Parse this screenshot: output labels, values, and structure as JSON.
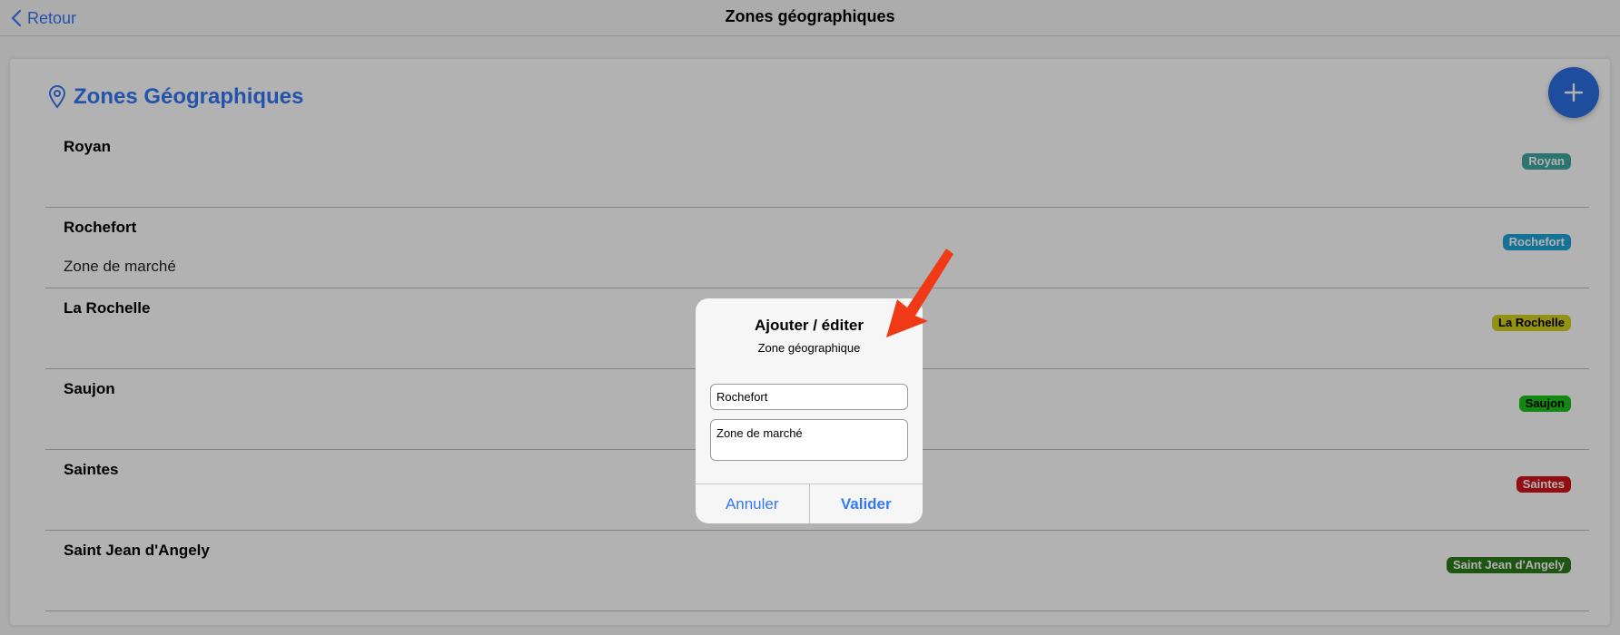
{
  "navbar": {
    "back_label": "Retour",
    "title": "Zones géographiques"
  },
  "card": {
    "title": "Zones Géographiques",
    "add_icon": "plus-icon"
  },
  "zones": [
    {
      "name": "Royan",
      "description": "",
      "badge": "Royan",
      "color": "#3ea6a0",
      "text_color": "#ffffff"
    },
    {
      "name": "Rochefort",
      "description": "Zone de marché",
      "badge": "Rochefort",
      "color": "#1fa4d8",
      "text_color": "#ffffff"
    },
    {
      "name": "La Rochelle",
      "description": "",
      "badge": "La Rochelle",
      "color": "#d4d11a",
      "text_color": "#000000"
    },
    {
      "name": "Saujon",
      "description": "",
      "badge": "Saujon",
      "color": "#1bc21b",
      "text_color": "#000000"
    },
    {
      "name": "Saintes",
      "description": "",
      "badge": "Saintes",
      "color": "#d0141a",
      "text_color": "#ffffff"
    },
    {
      "name": "Saint Jean d'Angely",
      "description": "",
      "badge": "Saint Jean d'Angely",
      "color": "#2c7a1c",
      "text_color": "#ffffff"
    }
  ],
  "dialog": {
    "title": "Ajouter / éditer",
    "subtitle": "Zone géographique",
    "name_value": "Rochefort",
    "description_value": "Zone de marché",
    "cancel_label": "Annuler",
    "confirm_label": "Valider"
  },
  "colors": {
    "accent": "#3478f6",
    "fab": "#2a6fe0",
    "annotation_arrow": "#f03a17"
  }
}
